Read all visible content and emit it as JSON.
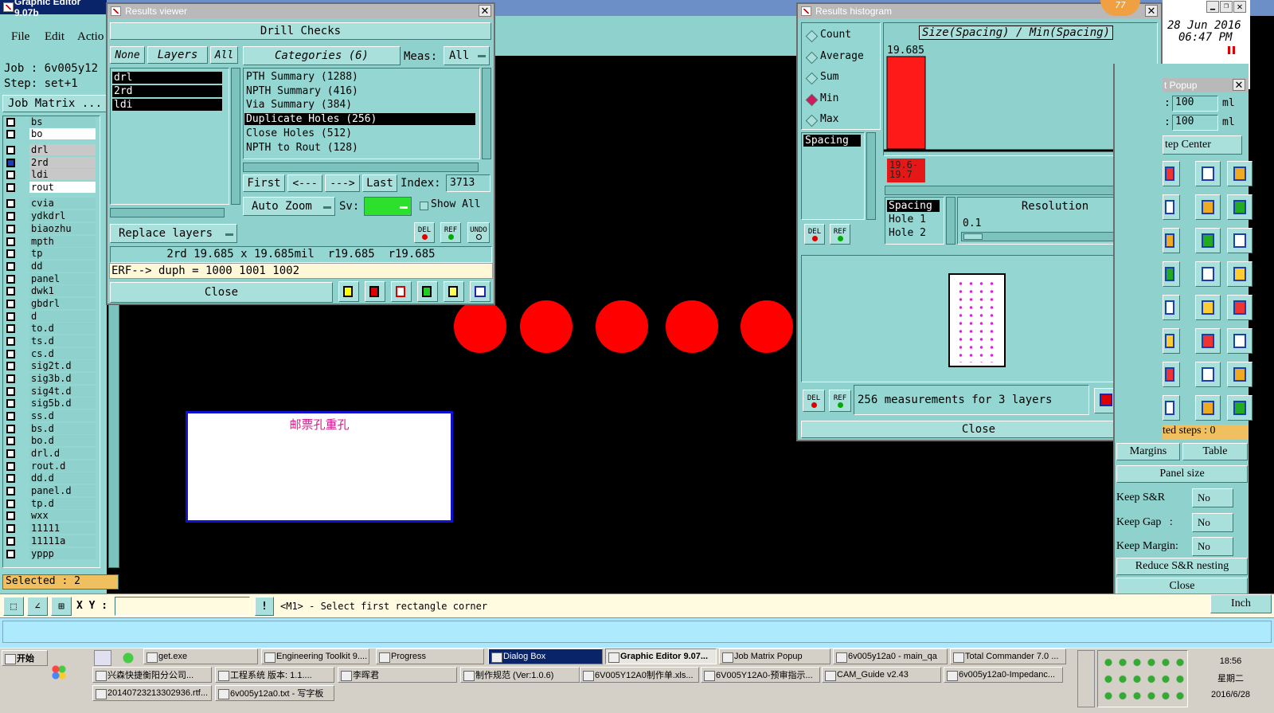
{
  "main": {
    "title": "Graphic Editor 9.07b",
    "menu": [
      "File",
      "Edit",
      "Actio"
    ],
    "job": "Job : 6v005y12",
    "step": "Step: set+1",
    "job_matrix": "Job Matrix ...",
    "selected": "Selected : 2",
    "xy_label": "X Y :",
    "status": "<M1> - Select first rectangle corner",
    "layers": [
      "bs",
      "bo",
      "drl",
      "2rd",
      "ldi",
      "rout",
      "cvia",
      "ydkdrl",
      "biaozhu",
      "mpth",
      "tp",
      "dd",
      "panel",
      "dwk1",
      "gbdrl",
      "d",
      "to.d",
      "ts.d",
      "cs.d",
      "sig2t.d",
      "sig3b.d",
      "sig4t.d",
      "sig5b.d",
      "ss.d",
      "bs.d",
      "bo.d",
      "drl.d",
      "rout.d",
      "dd.d",
      "panel.d",
      "tp.d",
      "wxx",
      "11111",
      "11111a",
      "yppp"
    ],
    "canvas_text": "邮票孔重孔"
  },
  "results_viewer": {
    "title": "Results viewer",
    "heading": "Drill Checks",
    "none": "None",
    "layers": "Layers",
    "all": "All",
    "layer_list": [
      "drl",
      "2rd",
      "ldi"
    ],
    "categories": "Categories (6)",
    "meas_label": "Meas:",
    "meas_value": "All",
    "category_list": [
      "PTH Summary (1288)",
      "NPTH Summary (416)",
      "Via Summary (384)",
      "Duplicate Holes (256)",
      "Close Holes (512)",
      "NPTH to Rout (128)"
    ],
    "first": "First",
    "prev": "<---",
    "next": "--->",
    "last": "Last",
    "index_label": "Index:",
    "index_value": "3713",
    "auto_zoom": "Auto Zoom",
    "sv": "Sv:",
    "show_all": "Show All",
    "replace_layers": "Replace layers",
    "del": "DEL",
    "ref": "REF",
    "undo": "UNDO",
    "measure": "2rd 19.685 x 19.685mil  r19.685  r19.685",
    "erf": "ERF--> duph = 1000 1001 1002",
    "close": "Close"
  },
  "histogram": {
    "title": "Results histogram",
    "options": [
      "Count",
      "Average",
      "Sum",
      "Min",
      "Max"
    ],
    "selected_option": "Min",
    "chart_title": "Size(Spacing) / Min(Spacing)",
    "field": "Spacing",
    "fields2": [
      "Spacing",
      "Hole 1",
      "Hole 2"
    ],
    "resolution_label": "Resolution",
    "resolution_value": "0.1",
    "measurements": "256 measurements for 3 layers",
    "close": "Close",
    "del": "DEL",
    "ref": "REF"
  },
  "chart_data": {
    "type": "bar",
    "categories": [
      "19.6-19.7"
    ],
    "values": [
      19.685
    ],
    "value_label": "19.685",
    "title": "Size(Spacing) / Min(Spacing)"
  },
  "right_panel": {
    "date": "28 Jun 2016",
    "time": "06:47 PM",
    "popup_title": "t Popup",
    "val1": "100",
    "val2": "100",
    "unit": "ml",
    "step_center": "tep Center",
    "selected_steps": "ted steps : 0",
    "margins": "Margins",
    "table": "Table",
    "panel_size": "Panel size",
    "keep_sr": "Keep S&R",
    "keep_gap": "Keep Gap   :",
    "keep_margin": "Keep Margin:",
    "no": "No",
    "reduce": "Reduce S&R nesting",
    "close": "Close",
    "inch": "Inch",
    "badge": "77"
  },
  "taskbar": {
    "start": "开始",
    "row1": [
      "get.exe",
      "Engineering Toolkit 9....",
      "Progress",
      "Dialog Box",
      "Graphic Editor 9.07...",
      "Job Matrix Popup",
      "6v005y12a0 - main_qa",
      "Total Commander 7.0 ..."
    ],
    "row2": [
      "兴森快捷衡阳分公司...",
      "工程系统  版本: 1.1....",
      "李晖君",
      "制作规范 (Ver:1.0.6)",
      "6V005Y12A0制作单.xls...",
      "6V005Y12A0-预审指示...",
      "CAM_Guide v2.43",
      "6v005y12a0-Impedanc..."
    ],
    "row3": [
      "20140723213302936.rtf...",
      "6v005y12a0.txt - 写字板"
    ],
    "clock_time": "18:56",
    "clock_day": "星期二",
    "clock_date": "2016/6/28"
  }
}
